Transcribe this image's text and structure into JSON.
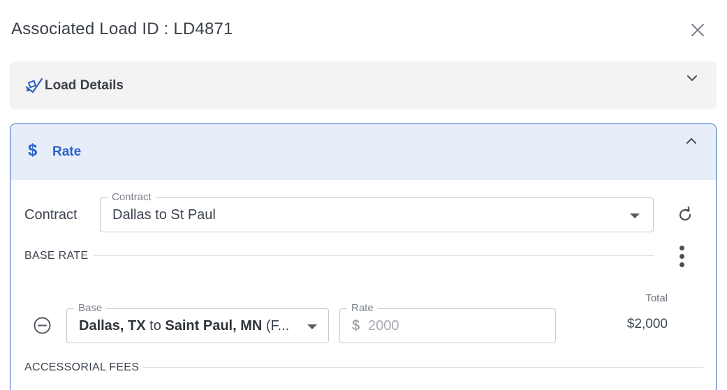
{
  "modal": {
    "title": "Associated Load ID : LD4871"
  },
  "load_details": {
    "label": "Load Details"
  },
  "rate": {
    "label": "Rate",
    "currency_icon": "$",
    "contract_label": "Contract",
    "contract_field": {
      "legend": "Contract",
      "value": "Dallas to St Paul"
    },
    "base_rate_title": "BASE RATE",
    "base_field": {
      "legend": "Base",
      "origin": "Dallas, TX",
      "connector": " to ",
      "destination": "Saint Paul, MN",
      "suffix": " (F..."
    },
    "rate_field": {
      "legend": "Rate",
      "currency": "$",
      "placeholder": "2000"
    },
    "total": {
      "label": "Total",
      "value": "$2,000"
    },
    "accessorial_title": "ACCESSORIAL FEES"
  },
  "colors": {
    "accent": "#2a62c9",
    "accent_bg": "#e8eef9",
    "panel_gray": "#f3f3f4",
    "border": "#c5c8cc"
  }
}
